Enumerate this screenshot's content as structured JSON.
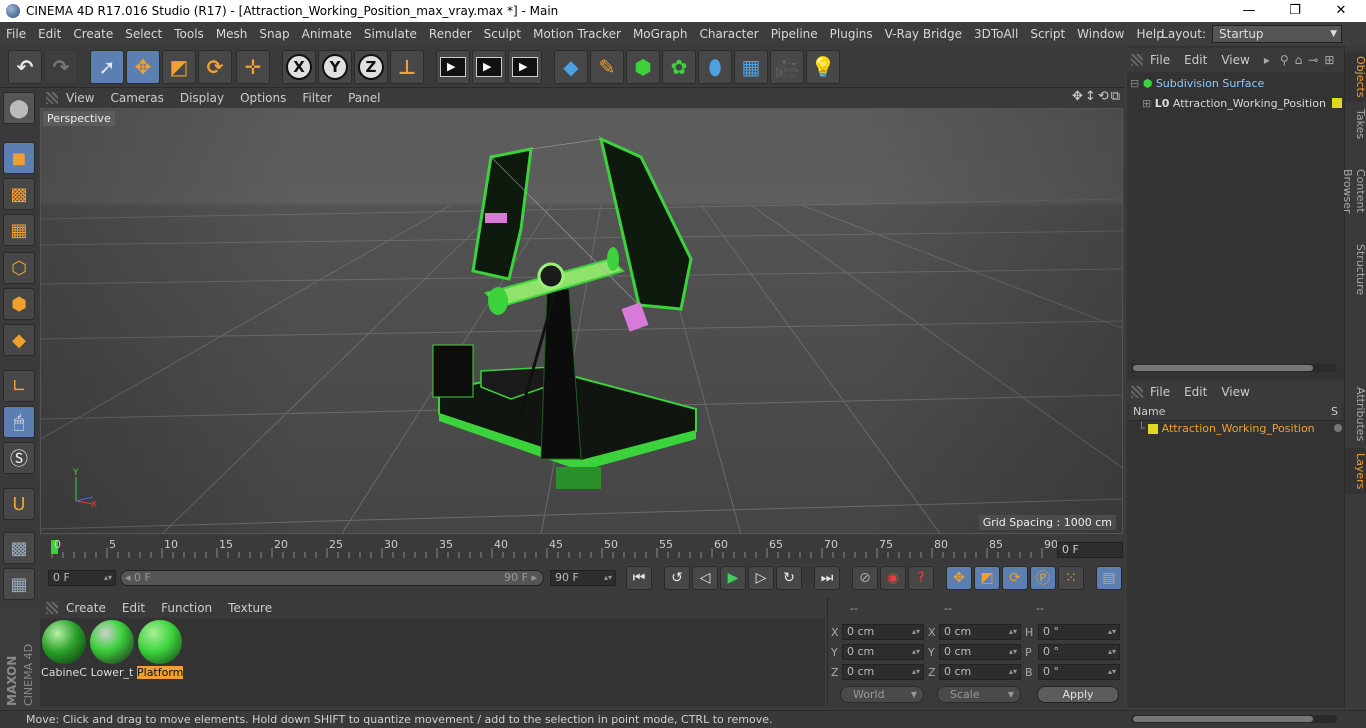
{
  "window": {
    "title": "CINEMA 4D R17.016 Studio (R17) - [Attraction_Working_Position_max_vray.max *] - Main",
    "minimize": "—",
    "maximize": "❐",
    "close": "✕"
  },
  "menu": [
    "File",
    "Edit",
    "Create",
    "Select",
    "Tools",
    "Mesh",
    "Snap",
    "Animate",
    "Simulate",
    "Render",
    "Sculpt",
    "Motion Tracker",
    "MoGraph",
    "Character",
    "Pipeline",
    "Plugins",
    "V-Ray Bridge",
    "3DToAll",
    "Script",
    "Window",
    "Help"
  ],
  "layout": {
    "label": "Layout:",
    "value": "Startup"
  },
  "toolbar": {
    "undo_icon": "undo-icon",
    "redo_icon": "redo-icon",
    "axis_labels": [
      "X",
      "Y",
      "Z"
    ]
  },
  "viewport": {
    "menu": [
      "View",
      "Cameras",
      "Display",
      "Options",
      "Filter",
      "Panel"
    ],
    "nav_icons": "✥↕⟲⧉",
    "camera_label": "Perspective",
    "grid_spacing": "Grid Spacing : 1000 cm"
  },
  "timeline": {
    "ticks": [
      "0",
      "5",
      "10",
      "15",
      "20",
      "25",
      "30",
      "35",
      "40",
      "45",
      "50",
      "55",
      "60",
      "65",
      "70",
      "75",
      "80",
      "85",
      "90"
    ],
    "current_frame": "0 F",
    "start_field": "0 F",
    "range_start": "◂ 0 F",
    "range_end": "90 F ▸",
    "end_field": "90 F"
  },
  "materials": {
    "menu": [
      "Create",
      "Edit",
      "Function",
      "Texture"
    ],
    "items": [
      {
        "name": "CabineC",
        "selected": false
      },
      {
        "name": "Lower_t",
        "selected": false
      },
      {
        "name": "Platform",
        "selected": true
      }
    ]
  },
  "coords": {
    "headers": [
      "--",
      "--",
      "--"
    ],
    "rows": [
      {
        "a": "X",
        "av": "0 cm",
        "b": "X",
        "bv": "0 cm",
        "c": "H",
        "cv": "0 °"
      },
      {
        "a": "Y",
        "av": "0 cm",
        "b": "Y",
        "bv": "0 cm",
        "c": "P",
        "cv": "0 °"
      },
      {
        "a": "Z",
        "av": "0 cm",
        "b": "Z",
        "bv": "0 cm",
        "c": "B",
        "cv": "0 °"
      }
    ],
    "world": "World",
    "scale": "Scale",
    "apply": "Apply"
  },
  "objects": {
    "menu": [
      "File",
      "Edit",
      "View"
    ],
    "tree": [
      {
        "label": "Subdivision Surface",
        "color": "#8fc8ff"
      },
      {
        "label": "Attraction_Working_Position",
        "color": "#d8d8d8"
      }
    ]
  },
  "layers": {
    "menu": [
      "File",
      "Edit",
      "View"
    ],
    "col_name": "Name",
    "col_s": "S",
    "items": [
      {
        "label": "Attraction_Working_Position",
        "color": "#f0a030"
      }
    ]
  },
  "sidetabs": [
    "Objects",
    "Takes",
    "Content Browser",
    "Structure",
    "Attributes",
    "Layers"
  ],
  "status": "Move: Click and drag to move elements. Hold down SHIFT to quantize movement / add to the selection in point mode, CTRL to remove.",
  "maxon": {
    "brand": "MAXON",
    "product": "CINEMA 4D"
  },
  "colors": {
    "accent": "#f0a030",
    "selected_blue": "#5a7fb0",
    "model_green": "#3cd23c"
  }
}
